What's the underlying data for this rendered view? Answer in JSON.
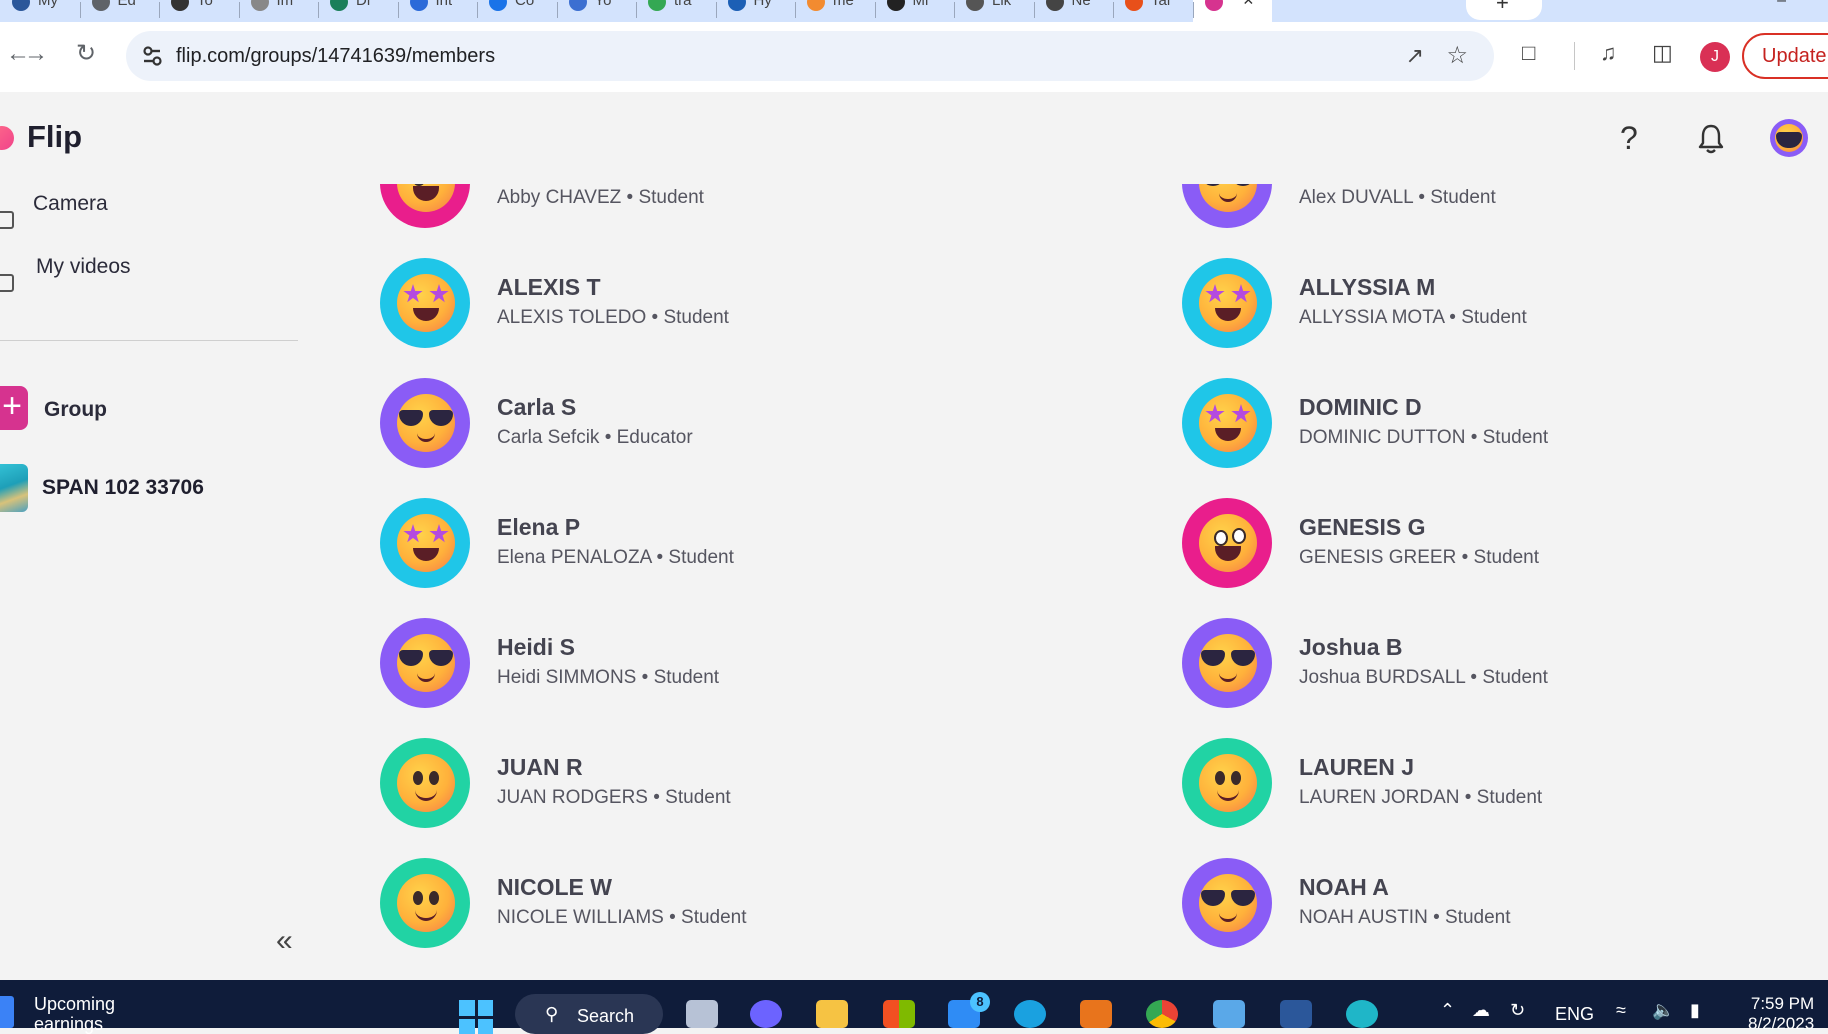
{
  "browser": {
    "tabs": [
      {
        "label": "My",
        "color": "#2b579a"
      },
      {
        "label": "Ed",
        "color": "#5f6368"
      },
      {
        "label": "To",
        "color": "#333333"
      },
      {
        "label": "Im",
        "color": "#888888"
      },
      {
        "label": "Di",
        "color": "#1a7f5a"
      },
      {
        "label": "Int",
        "color": "#2b6ad9"
      },
      {
        "label": "Co",
        "color": "#1a73e8"
      },
      {
        "label": "Yo",
        "color": "#3c6fd1"
      },
      {
        "label": "tra",
        "color": "#34a853"
      },
      {
        "label": "Hy",
        "color": "#1c5fb5"
      },
      {
        "label": "me",
        "color": "#f28b30"
      },
      {
        "label": "Mi",
        "color": "#222222"
      },
      {
        "label": "Lik",
        "color": "#555555"
      },
      {
        "label": "Ne",
        "color": "#444444"
      },
      {
        "label": "Tal",
        "color": "#e8501a"
      },
      {
        "label": "",
        "color": "#d6338f"
      }
    ],
    "new_tab_label": "+",
    "minimize_label": "–",
    "url": "flip.com/groups/14741639/members",
    "update_label": "Update",
    "profile_initial": "J"
  },
  "app": {
    "logo_text": "Flip",
    "help_label": "?"
  },
  "sidebar": {
    "camera_label": "Camera",
    "my_videos_label": "My videos",
    "group_label": "Group",
    "group_plus": "+",
    "group_name": "SPAN 102 33706",
    "collapse_label": "«"
  },
  "members": {
    "left": [
      {
        "name": "",
        "subtitle": "Abby CHAVEZ • Student",
        "avatar": "grin",
        "bg": "#e91e8c"
      },
      {
        "name": "ALEXIS T",
        "subtitle": "ALEXIS TOLEDO • Student",
        "avatar": "star",
        "bg": "#1fc6e8"
      },
      {
        "name": "Carla S",
        "subtitle": "Carla Sefcik • Educator",
        "avatar": "cool",
        "bg": "#8a5cf6"
      },
      {
        "name": "Elena P",
        "subtitle": "Elena PENALOZA • Student",
        "avatar": "star",
        "bg": "#1fc6e8"
      },
      {
        "name": "Heidi S",
        "subtitle": "Heidi SIMMONS • Student",
        "avatar": "cool",
        "bg": "#8a5cf6"
      },
      {
        "name": "JUAN R",
        "subtitle": "JUAN RODGERS • Student",
        "avatar": "smile",
        "bg": "#21d3a4"
      },
      {
        "name": "NICOLE W",
        "subtitle": "NICOLE WILLIAMS • Student",
        "avatar": "smile",
        "bg": "#21d3a4"
      }
    ],
    "right": [
      {
        "name": "",
        "subtitle": "Alex DUVALL • Student",
        "avatar": "cool",
        "bg": "#8a5cf6"
      },
      {
        "name": "ALLYSSIA M",
        "subtitle": "ALLYSSIA MOTA • Student",
        "avatar": "star",
        "bg": "#1fc6e8"
      },
      {
        "name": "DOMINIC D",
        "subtitle": "DOMINIC DUTTON • Student",
        "avatar": "star",
        "bg": "#1fc6e8"
      },
      {
        "name": "GENESIS G",
        "subtitle": "GENESIS GREER • Student",
        "avatar": "grin",
        "bg": "#e91e8c"
      },
      {
        "name": "Joshua B",
        "subtitle": "Joshua BURDSALL • Student",
        "avatar": "cool",
        "bg": "#8a5cf6"
      },
      {
        "name": "LAUREN J",
        "subtitle": "LAUREN JORDAN • Student",
        "avatar": "smile",
        "bg": "#21d3a4"
      },
      {
        "name": "NOAH A",
        "subtitle": "NOAH AUSTIN • Student",
        "avatar": "cool",
        "bg": "#8a5cf6"
      }
    ]
  },
  "taskbar": {
    "weather_line1": "Upcoming",
    "weather_line2": "earnings",
    "search_label": "Search",
    "mail_badge": "8",
    "language": "ENG",
    "time": "7:59 PM",
    "date": "8/2/2023"
  }
}
